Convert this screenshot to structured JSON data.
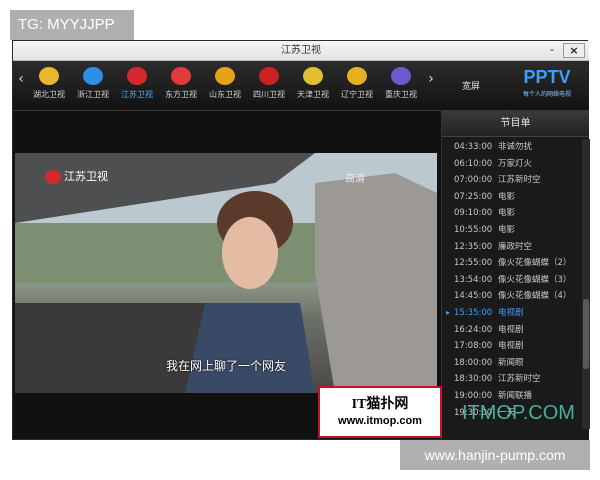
{
  "watermarks": {
    "top_tag": "TG: MYYJJPP",
    "bottom_tag": "www.hanjin-pump.com",
    "site_overlay": "ITMOP.COM"
  },
  "window": {
    "title": "江苏卫视",
    "minimize": "-",
    "close": "×"
  },
  "channelbar": {
    "left_arrow": "‹",
    "right_arrow": "›",
    "channels": [
      {
        "label": "湖北卫视",
        "logo": "hubei-logo-icon",
        "color": "#e8b72d"
      },
      {
        "label": "浙江卫视",
        "logo": "zhejiang-logo-icon",
        "color": "#2d8fe8"
      },
      {
        "label": "江苏卫视",
        "logo": "jiangsu-logo-icon",
        "color": "#d7282f"
      },
      {
        "label": "东方卫视",
        "logo": "dongfang-logo-icon",
        "color": "#e33a3a"
      },
      {
        "label": "山东卫视",
        "logo": "shandong-logo-icon",
        "color": "#e6a119"
      },
      {
        "label": "四川卫视",
        "logo": "sichuan-logo-icon",
        "color": "#cc2222"
      },
      {
        "label": "天津卫视",
        "logo": "tianjin-logo-icon",
        "color": "#e0c030"
      },
      {
        "label": "辽宁卫视",
        "logo": "liaoning-logo-icon",
        "color": "#e2b020"
      },
      {
        "label": "重庆卫视",
        "logo": "chongqing-logo-icon",
        "color": "#6a5acd"
      }
    ],
    "active_index": 2,
    "wide_button": "宽屏",
    "brand_name": "PPTV",
    "brand_tag": "每个人的网络电视"
  },
  "video": {
    "channel_watermark": "江苏卫视",
    "corner_watermark": "高清",
    "subtitle": "我在网上聊了一个网友"
  },
  "overlay": {
    "line1": "IT猫扑网",
    "line2": "www.itmop.com"
  },
  "schedule": {
    "title": "节目单",
    "current_index": 11,
    "items": [
      {
        "time": "04:33:00",
        "title": "非诚勿扰"
      },
      {
        "time": "06:10:00",
        "title": "万家灯火"
      },
      {
        "time": "07:00:00",
        "title": "江苏新时空"
      },
      {
        "time": "07:25:00",
        "title": "电影"
      },
      {
        "time": "09:10:00",
        "title": "电影"
      },
      {
        "time": "10:55:00",
        "title": "电影"
      },
      {
        "time": "12:35:00",
        "title": "廉政时空"
      },
      {
        "time": "12:55:00",
        "title": "像火花像蝴蝶（2）"
      },
      {
        "time": "13:54:00",
        "title": "像火花像蝴蝶（3）"
      },
      {
        "time": "14:45:00",
        "title": "像火花像蝴蝶（4）"
      },
      {
        "time": "15:35:00",
        "title": "电视剧"
      },
      {
        "time": "16:24:00",
        "title": "电视剧"
      },
      {
        "time": "17:08:00",
        "title": "电视剧"
      },
      {
        "time": "18:00:00",
        "title": "新闻眼"
      },
      {
        "time": "18:30:00",
        "title": "江苏新时空"
      },
      {
        "time": "19:00:00",
        "title": "新闻联播"
      },
      {
        "time": "19:30:00",
        "title": "一天"
      }
    ],
    "down_arrow": "⌄"
  }
}
